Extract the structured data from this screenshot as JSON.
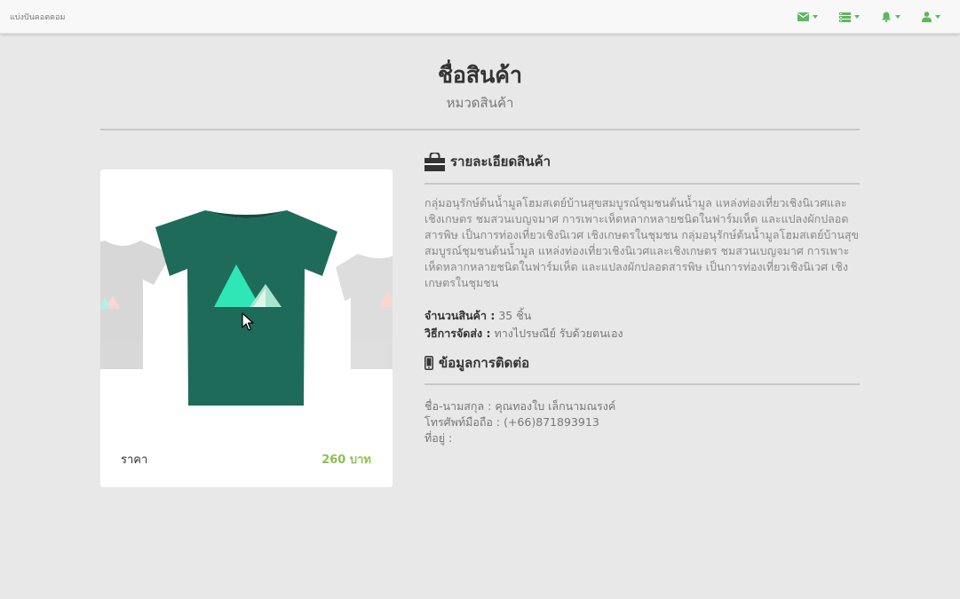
{
  "navbar": {
    "brand": "แบ่งปันคอตคอม",
    "icons": [
      "envelope-icon",
      "list-icon",
      "bell-icon",
      "user-icon"
    ],
    "accent": "#5cb85c"
  },
  "product": {
    "title": "ชื่อสินค้า",
    "category": "หมวดสินค้า",
    "price_label": "ราคา",
    "price_value": "260 บาท",
    "price_color": "#8cc152"
  },
  "details": {
    "heading": "รายละเอียดสินค้า",
    "description": "กลุ่มอนุรักษ์ต้นน้ำมูลโฮมสเตย์บ้านสุขสมบูรณ์ชุมชนต้นน้ำมูล แหล่งท่องเที่ยวเชิงนิเวศและเชิงเกษตร ชมสวนเบญจมาศ การเพาะเห็ดหลากหลายชนิดในฟาร์มเห็ด และแปลงผักปลอดสารพิษ เป็นการท่องเที่ยวเชิงนิเวศ เชิงเกษตรในชุมชน กลุ่มอนุรักษ์ต้นน้ำมูลโฮมสเตย์บ้านสุขสมบูรณ์ชุมชนต้นน้ำมูล แหล่งท่องเที่ยวเชิงนิเวศและเชิงเกษตร ชมสวนเบญจมาศ การเพาะเห็ดหลากหลายชนิดในฟาร์มเห็ด และแปลงผักปลอดสารพิษ เป็นการท่องเที่ยวเชิงนิเวศ เชิงเกษตรในชุมชน",
    "qty_label": "จำนวนสินค้า :",
    "qty_value": "35 ชิ้น",
    "ship_label": "วิธีการจัดส่ง :",
    "ship_value": "ทางไปรษณีย์ รับด้วยตนเอง"
  },
  "contact": {
    "heading": "ข้อมูลการติดต่อ",
    "name": "ชื่อ-นามสกุล : คุณทองใบ เล็กนามณรงค์",
    "phone": "โทรศัพท์มือถือ : (+66)871893913",
    "address": "ที่อยู่ :"
  }
}
